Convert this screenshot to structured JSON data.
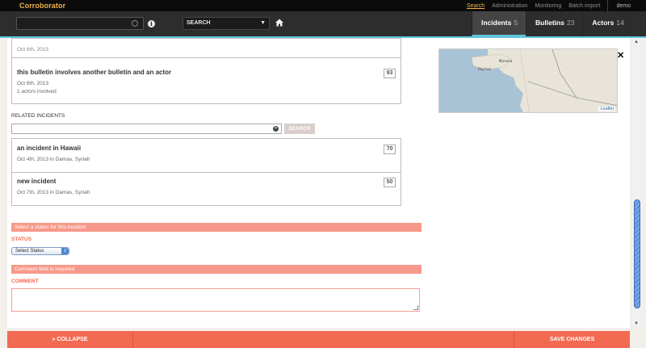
{
  "app": {
    "title": "Corroborator"
  },
  "topnav": {
    "items": [
      "Search",
      "Administration",
      "Monitoring",
      "Batch import"
    ],
    "user": "demo"
  },
  "navbar": {
    "search_placeholder": "",
    "search_type": "SEARCH",
    "tabs": [
      {
        "label": "Incidents",
        "count": "5"
      },
      {
        "label": "Bulletins",
        "count": "23"
      },
      {
        "label": "Actors",
        "count": "14"
      }
    ]
  },
  "bulletins": {
    "partial_date": "Oct 6th, 2013",
    "item": {
      "title": "this bulletin involves another bulletin and an actor",
      "date": "Oct 6th, 2013",
      "actors": "1 actors involved",
      "number": "93"
    }
  },
  "related_incidents": {
    "label": "RELATED INCIDENTS",
    "search_button": "SEARCH",
    "items": [
      {
        "title": "an incident in Hawaii",
        "meta": "Oct 4th, 2013 in Damas, Syriah",
        "number": "70"
      },
      {
        "title": "new incident",
        "meta": "Oct 7th, 2013 in Damas, Syriah",
        "number": "50"
      }
    ]
  },
  "status": {
    "error": "Select a status for this incident",
    "label": "STATUS",
    "selected": "Select Status"
  },
  "comment": {
    "error": "Comment field is required",
    "label": "COMMENT",
    "value": ""
  },
  "map": {
    "attribution": "Leaflet",
    "places": [
      "Nicosia",
      "Paphos"
    ]
  },
  "footer": {
    "collapse": "» COLLAPSE",
    "save": "SAVE CHANGES"
  },
  "colors": {
    "accent": "#5ec4dc",
    "error": "#f7998a",
    "brand": "#f0b446",
    "action": "#f26a52"
  }
}
